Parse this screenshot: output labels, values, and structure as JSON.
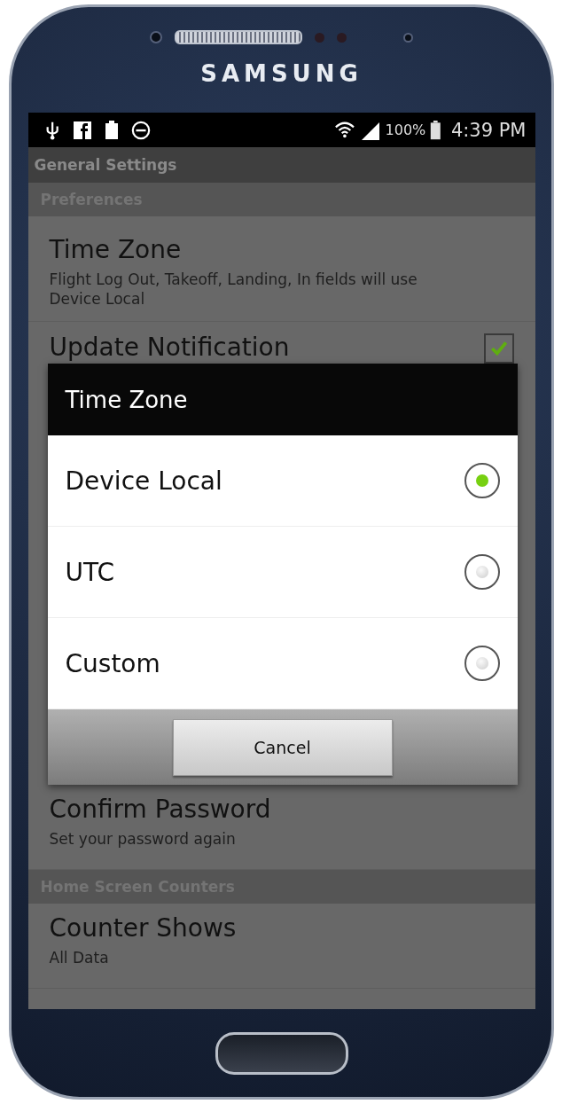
{
  "device": {
    "brand": "SAMSUNG"
  },
  "status_bar": {
    "battery_percent": "100%",
    "time": "4:39 PM"
  },
  "action_bar": {
    "title": "General Settings"
  },
  "settings_top": [
    {
      "kind": "header",
      "label": "Preferences"
    },
    {
      "kind": "item",
      "title": "Time Zone",
      "subtitle": "Flight Log Out, Takeoff, Landing, In fields will use Device Local"
    },
    {
      "kind": "checkbox",
      "title": "Update Notification",
      "checked": true
    }
  ],
  "dialog": {
    "title": "Time Zone",
    "options": [
      {
        "label": "Device Local",
        "selected": true
      },
      {
        "label": "UTC",
        "selected": false
      },
      {
        "label": "Custom",
        "selected": false
      }
    ],
    "cancel": "Cancel"
  },
  "settings_bottom": [
    {
      "kind": "item",
      "title": "Confirm Password",
      "subtitle": "Set your password again"
    },
    {
      "kind": "header",
      "label": "Home Screen Counters"
    },
    {
      "kind": "item",
      "title": "Counter Shows",
      "subtitle": "All Data"
    }
  ]
}
